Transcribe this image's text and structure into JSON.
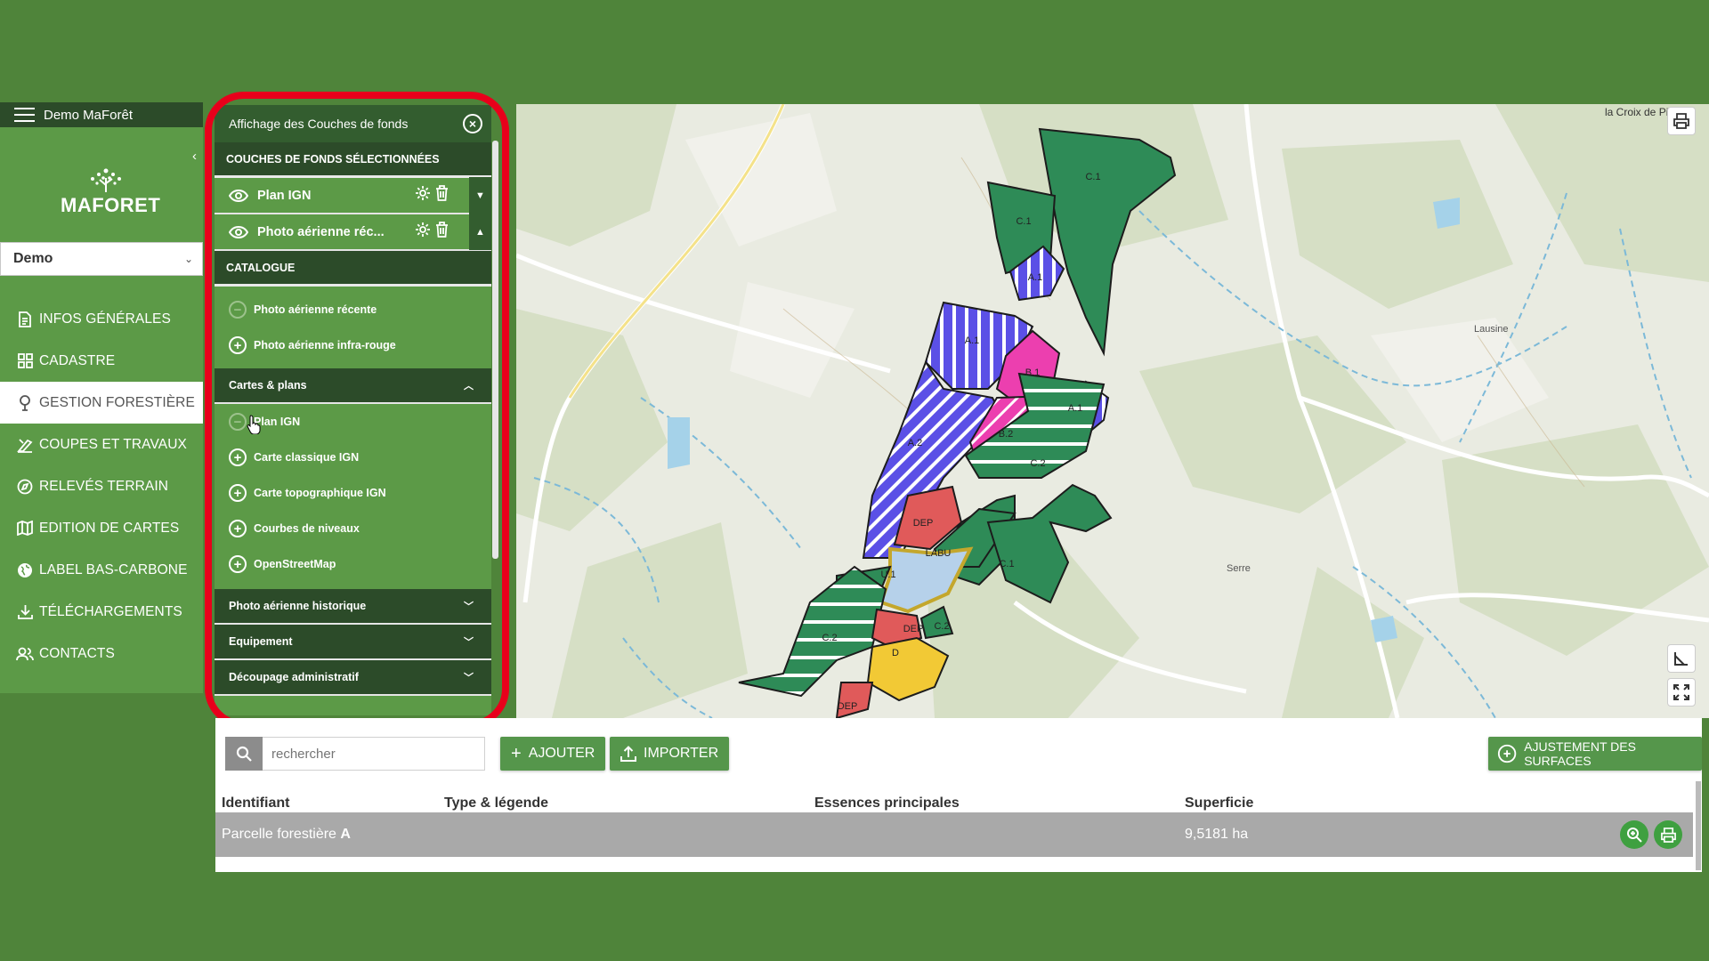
{
  "app": {
    "title": "Demo MaForêt",
    "brand": "MAFORET"
  },
  "project_select": {
    "value": "Demo"
  },
  "nav": {
    "items": [
      {
        "label": "INFOS GÉNÉRALES"
      },
      {
        "label": "CADASTRE"
      },
      {
        "label": "GESTION FORESTIÈRE"
      },
      {
        "label": "COUPES ET TRAVAUX"
      },
      {
        "label": "RELEVÉS TERRAIN"
      },
      {
        "label": "EDITION DE CARTES"
      },
      {
        "label": "LABEL BAS-CARBONE"
      },
      {
        "label": "TÉLÉCHARGEMENTS"
      },
      {
        "label": "CONTACTS"
      }
    ],
    "active_index": 2
  },
  "layers_panel": {
    "title": "Affichage des Couches de fonds",
    "selected_heading": "COUCHES DE FONDS SÉLECTIONNÉES",
    "selected_layers": [
      {
        "name": "Plan IGN"
      },
      {
        "name": "Photo aérienne réc..."
      }
    ],
    "catalogue_heading": "CATALOGUE",
    "catalogue_items": [
      {
        "label": "Photo aérienne récente",
        "state": "added"
      },
      {
        "label": "Photo aérienne infra-rouge",
        "state": "available"
      }
    ],
    "groups": [
      {
        "label": "Cartes & plans",
        "expanded": true,
        "items": [
          {
            "label": "Plan IGN",
            "state": "added"
          },
          {
            "label": "Carte classique IGN",
            "state": "available"
          },
          {
            "label": "Carte topographique IGN",
            "state": "available"
          },
          {
            "label": "Courbes de niveaux",
            "state": "available"
          },
          {
            "label": "OpenStreetMap",
            "state": "available"
          }
        ]
      },
      {
        "label": "Photo aérienne historique",
        "expanded": false
      },
      {
        "label": "Equipement",
        "expanded": false
      },
      {
        "label": "Découpage administratif",
        "expanded": false
      }
    ]
  },
  "map": {
    "places": [
      "la Croix de Pi",
      "Lausine",
      "Serre"
    ],
    "parcels": [
      "C.1",
      "C.1",
      "A.1",
      "A.1",
      "B.1",
      "A.1",
      "A.2",
      "B.2",
      "C.2",
      "DEP",
      "LABU",
      "C.1",
      "U.1",
      "DEP",
      "C.2",
      "C.2",
      "D",
      "DEP"
    ]
  },
  "toolbar": {
    "search_placeholder": "rechercher",
    "add_label": "AJOUTER",
    "import_label": "IMPORTER",
    "adjust_label": "AJUSTEMENT DES SURFACES"
  },
  "table": {
    "headers": [
      "Identifiant",
      "Type & légende",
      "Essences principales",
      "Superficie"
    ],
    "rows": [
      {
        "identifiant": "Parcelle forestière",
        "identifiant_bold": "A",
        "superficie": "9,5181 ha"
      }
    ]
  },
  "colors": {
    "background": "#4f843a",
    "sidebar": "#5c9a47",
    "dark_header": "#2c4b29",
    "highlight": "#e8001b"
  }
}
